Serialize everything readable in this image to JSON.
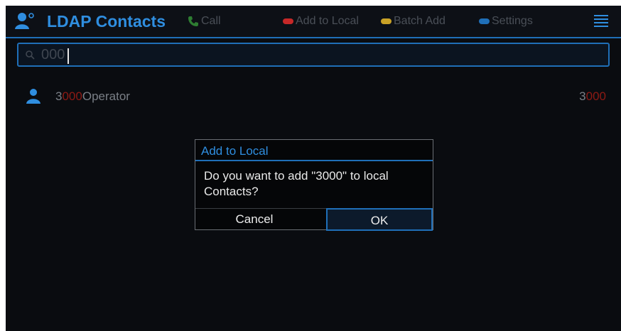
{
  "header": {
    "title": "LDAP Contacts",
    "app_icon": "contact-icon",
    "softkeys": [
      {
        "label": "Call",
        "icon": "phone-icon",
        "color": "#2e7d32"
      },
      {
        "label": "Add to Local",
        "color": "#c62828"
      },
      {
        "label": "Batch Add",
        "color": "#c9a227"
      },
      {
        "label": "Settings",
        "color": "#1f6fb8"
      }
    ],
    "menu_icon": "menu-icon"
  },
  "search": {
    "icon": "search-icon",
    "value": "000"
  },
  "results": [
    {
      "name_prefix": "3",
      "name_match": "000",
      "name_suffix": "Operator",
      "number_prefix": "3",
      "number_match": "000"
    }
  ],
  "dialog": {
    "title": "Add to Local",
    "message": "Do you want to add \"3000\" to local Contacts?",
    "cancel_label": "Cancel",
    "ok_label": "OK"
  },
  "colors": {
    "accent": "#2f8ee0",
    "highlight": "#8e1a14",
    "background": "#0a0c10"
  }
}
